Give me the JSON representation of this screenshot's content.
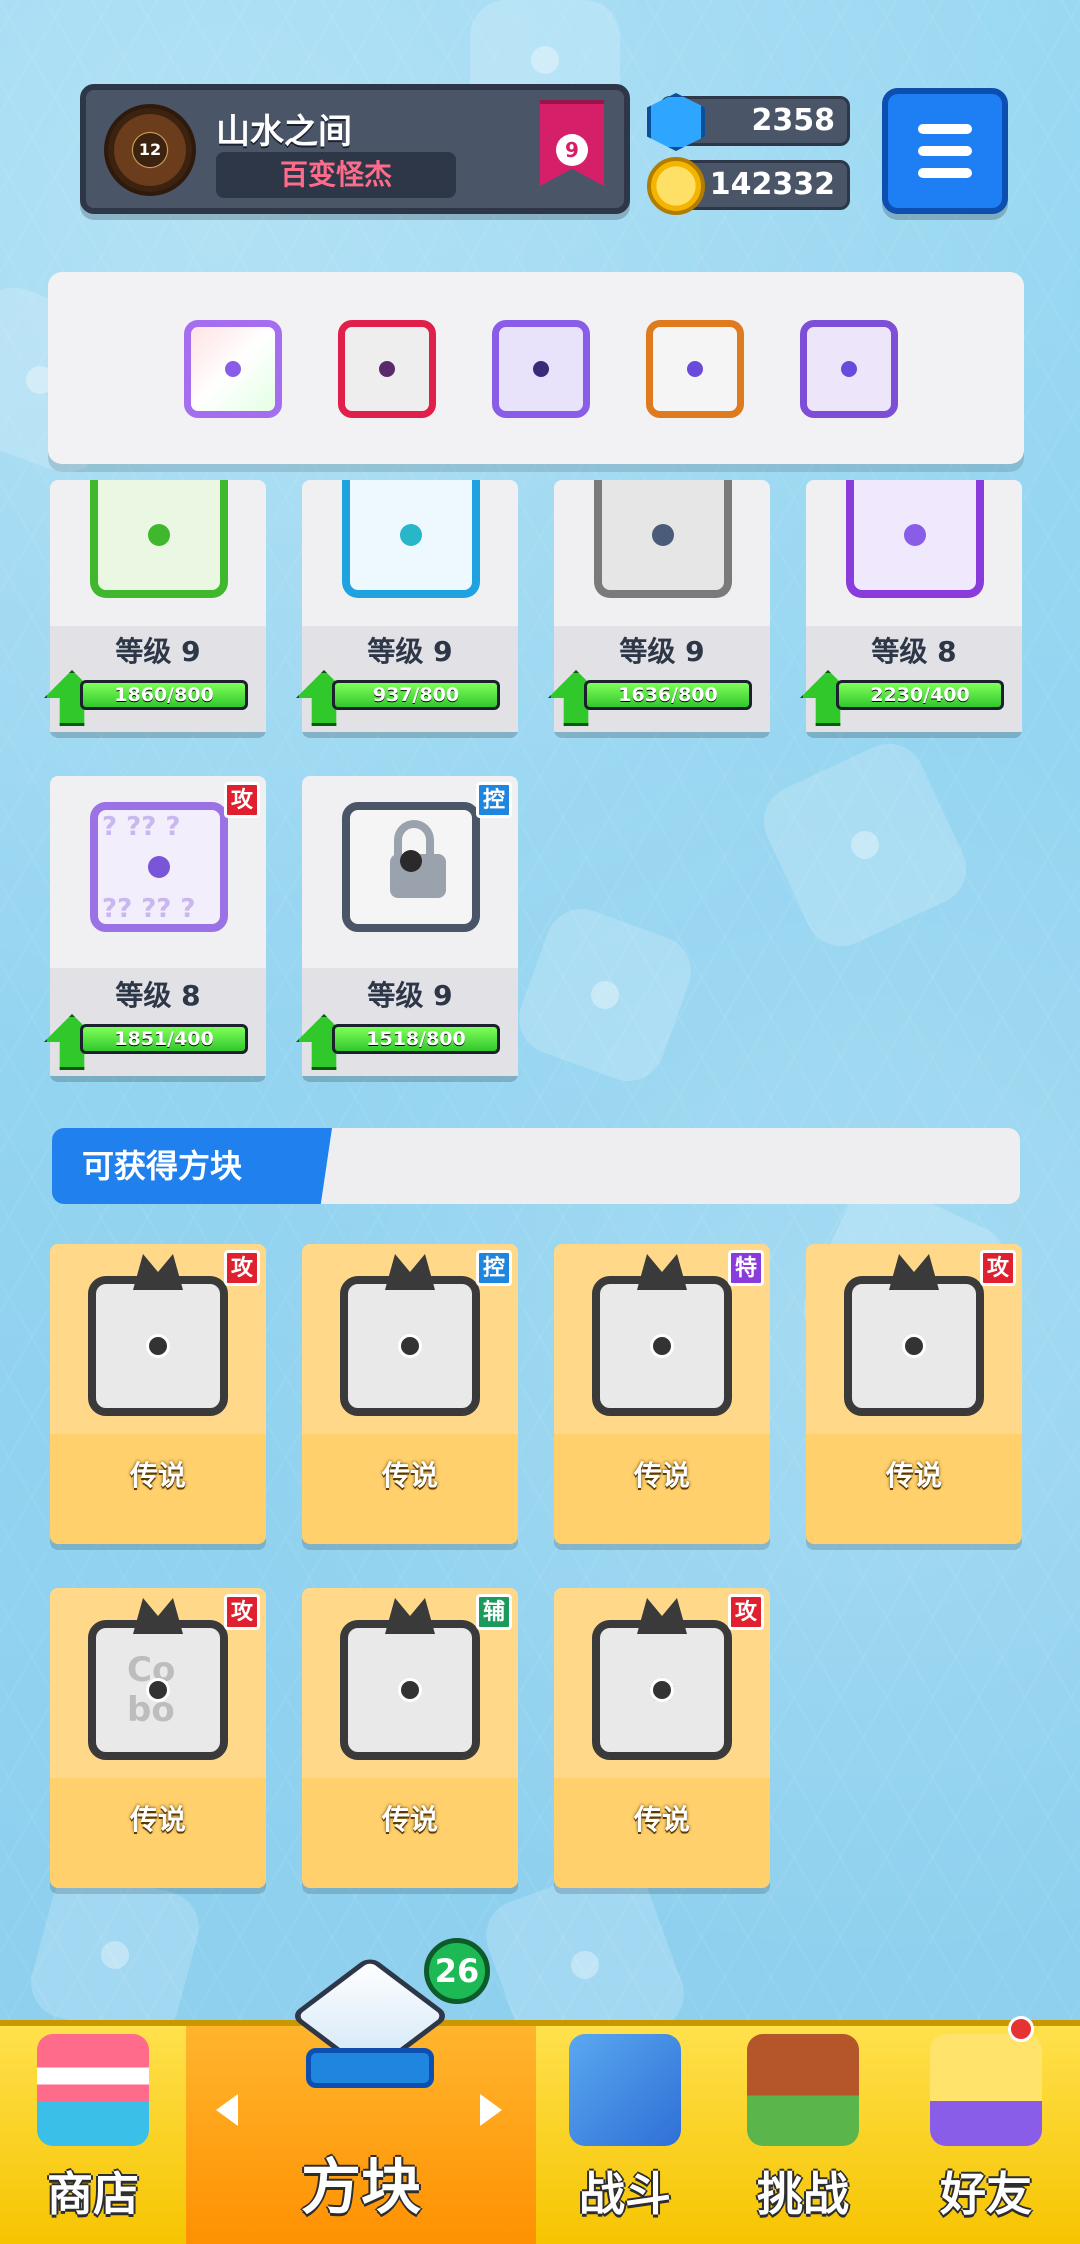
{
  "header": {
    "player_name": "山水之间",
    "player_title": "百变怪杰",
    "avatar_level": "12",
    "rank_level": "9",
    "gems": "2358",
    "coins": "142332"
  },
  "deck": {
    "slots": [
      {
        "icon": "rainbow-dice-icon",
        "color": "#a56df0"
      },
      {
        "icon": "saw-blade-dice-icon",
        "color": "#e0204a"
      },
      {
        "icon": "crack-dice-icon",
        "color": "#8a5de8"
      },
      {
        "icon": "infinity-dice-icon",
        "color": "#e07a1f"
      },
      {
        "icon": "spiral-dice-icon",
        "color": "#7d4fd6"
      }
    ]
  },
  "owned_cards": [
    {
      "level": "等级 9",
      "progress": "1860/800",
      "progress_fraction": 1.0,
      "color": "#3fb82e",
      "pip": "#3fb82e",
      "tag": ""
    },
    {
      "level": "等级 9",
      "progress": "937/800",
      "progress_fraction": 1.0,
      "color": "#1fa3e0",
      "pip": "#28b7c9",
      "tag": ""
    },
    {
      "level": "等级 9",
      "progress": "1636/800",
      "progress_fraction": 1.0,
      "color": "#7a7a7a",
      "pip": "#4a5c7a",
      "tag": ""
    },
    {
      "level": "等级 8",
      "progress": "2230/400",
      "progress_fraction": 1.0,
      "color": "#8a3bdb",
      "pip": "#8a5de8",
      "tag": ""
    },
    {
      "level": "等级 8",
      "progress": "1851/400",
      "progress_fraction": 1.0,
      "color": "#9a72e6",
      "pip": "#7a55d8",
      "tag": "攻",
      "tag_color": "#e0202e"
    },
    {
      "level": "等级 9",
      "progress": "1518/800",
      "progress_fraction": 1.0,
      "color": "#4a5568",
      "pip": "#2a2a2a",
      "tag": "控",
      "tag_color": "#1f86e0"
    }
  ],
  "obtainable": {
    "title": "可获得方块",
    "cards": [
      {
        "rarity": "传说",
        "tag": "攻",
        "tag_color": "#e0202e",
        "mark": ""
      },
      {
        "rarity": "传说",
        "tag": "控",
        "tag_color": "#1f86e0",
        "mark": ""
      },
      {
        "rarity": "传说",
        "tag": "特",
        "tag_color": "#8a3bdb",
        "mark": ""
      },
      {
        "rarity": "传说",
        "tag": "攻",
        "tag_color": "#e0202e",
        "mark": ""
      },
      {
        "rarity": "传说",
        "tag": "攻",
        "tag_color": "#e0202e",
        "mark": "Co bo"
      },
      {
        "rarity": "传说",
        "tag": "辅",
        "tag_color": "#1b9a5c",
        "mark": ""
      },
      {
        "rarity": "传说",
        "tag": "攻",
        "tag_color": "#e0202e",
        "mark": "★"
      }
    ]
  },
  "nav": {
    "shop": "商店",
    "dice": "方块",
    "battle": "战斗",
    "challenge": "挑战",
    "friends": "好友",
    "dice_badge": "26"
  }
}
